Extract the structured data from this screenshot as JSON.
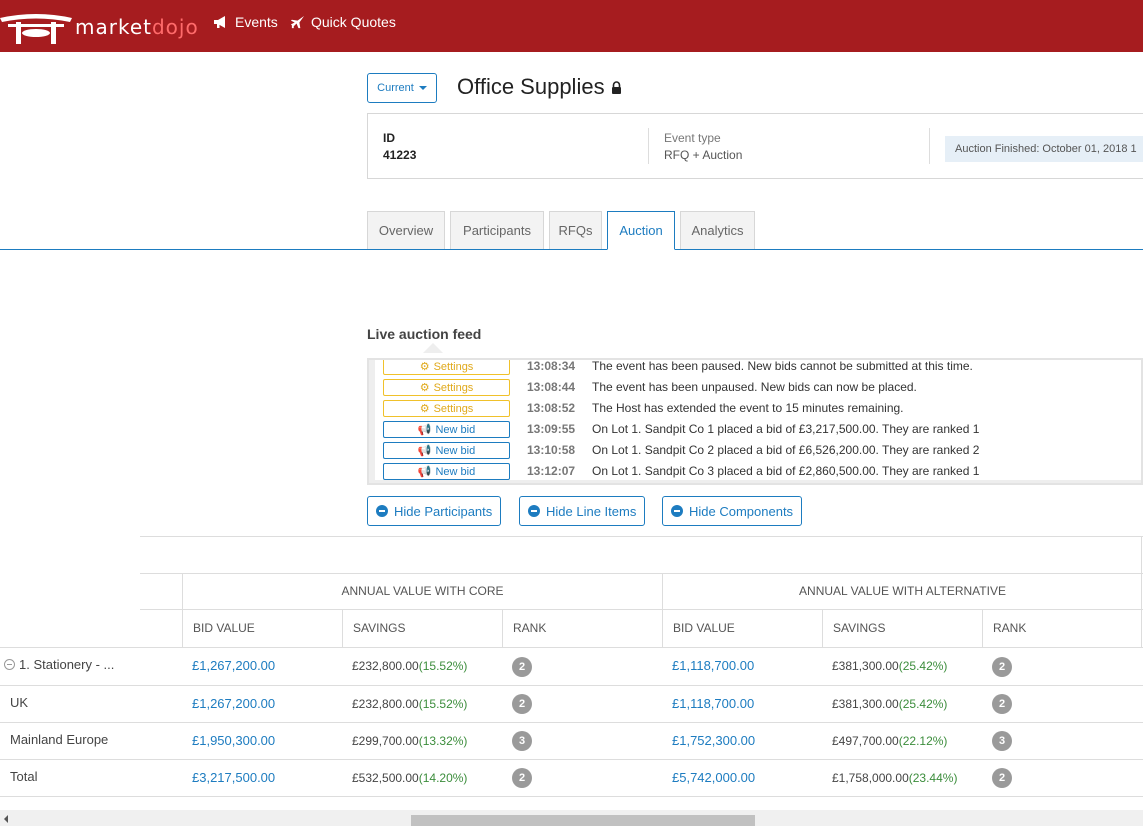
{
  "nav": {
    "brand_part1": "market",
    "brand_part2": "dojo",
    "events_label": "Events",
    "quick_quotes_label": "Quick Quotes",
    "brand_color": "#a61c1f"
  },
  "header": {
    "version_select": "Current",
    "title": "Office Supplies",
    "id_label": "ID",
    "id_value": "41223",
    "event_type_label": "Event type",
    "event_type_value": "RFQ + Auction",
    "status": "Auction Finished: October 01, 2018 1"
  },
  "tabs": [
    {
      "label": "Overview"
    },
    {
      "label": "Participants"
    },
    {
      "label": "RFQs"
    },
    {
      "label": "Auction",
      "active": true
    },
    {
      "label": "Analytics"
    }
  ],
  "feed": {
    "title": "Live auction feed",
    "rows": [
      {
        "type": "Settings",
        "time": "13:08:34",
        "message": "The event has been paused. New bids cannot be submitted at this time."
      },
      {
        "type": "Settings",
        "time": "13:08:44",
        "message": "The event has been unpaused. New bids can now be placed."
      },
      {
        "type": "Settings",
        "time": "13:08:52",
        "message": "The Host has extended the event to 15 minutes remaining."
      },
      {
        "type": "New bid",
        "time": "13:09:55",
        "message": "On Lot 1. Sandpit Co 1 placed a bid of £3,217,500.00. They are ranked 1"
      },
      {
        "type": "New bid",
        "time": "13:10:58",
        "message": "On Lot 1. Sandpit Co 2 placed a bid of £6,526,200.00. They are ranked 2"
      },
      {
        "type": "New bid",
        "time": "13:12:07",
        "message": "On Lot 1. Sandpit Co 3 placed a bid of £2,860,500.00. They are ranked 1"
      }
    ]
  },
  "buttons": {
    "hide_participants": "Hide Participants",
    "hide_line_items": "Hide Line Items",
    "hide_components": "Hide Components"
  },
  "table": {
    "group_core": "ANNUAL VALUE WITH CORE",
    "group_alt": "ANNUAL VALUE WITH ALTERNATIVE",
    "columns": [
      "BID VALUE",
      "SAVINGS",
      "RANK",
      "BID VALUE",
      "SAVINGS",
      "RANK"
    ],
    "rows": [
      {
        "label": "1. Stationery - ...",
        "core_bid": "£1,267,200.00",
        "core_sav": "£232,800.00",
        "core_pct": "(15.52%)",
        "core_rank": "2",
        "alt_bid": "£1,118,700.00",
        "alt_sav": "£381,300.00",
        "alt_pct": "(25.42%)",
        "alt_rank": "2"
      },
      {
        "label": "UK",
        "core_bid": "£1,267,200.00",
        "core_sav": "£232,800.00",
        "core_pct": "(15.52%)",
        "core_rank": "2",
        "alt_bid": "£1,118,700.00",
        "alt_sav": "£381,300.00",
        "alt_pct": "(25.42%)",
        "alt_rank": "2"
      },
      {
        "label": "Mainland Europe",
        "core_bid": "£1,950,300.00",
        "core_sav": "£299,700.00",
        "core_pct": "(13.32%)",
        "core_rank": "3",
        "alt_bid": "£1,752,300.00",
        "alt_sav": "£497,700.00",
        "alt_pct": "(22.12%)",
        "alt_rank": "3"
      },
      {
        "label": "Total",
        "core_bid": "£3,217,500.00",
        "core_sav": "£532,500.00",
        "core_pct": "(14.20%)",
        "core_rank": "2",
        "alt_bid": "£5,742,000.00",
        "alt_sav": "£1,758,000.00",
        "alt_pct": "(23.44%)",
        "alt_rank": "2"
      }
    ]
  }
}
